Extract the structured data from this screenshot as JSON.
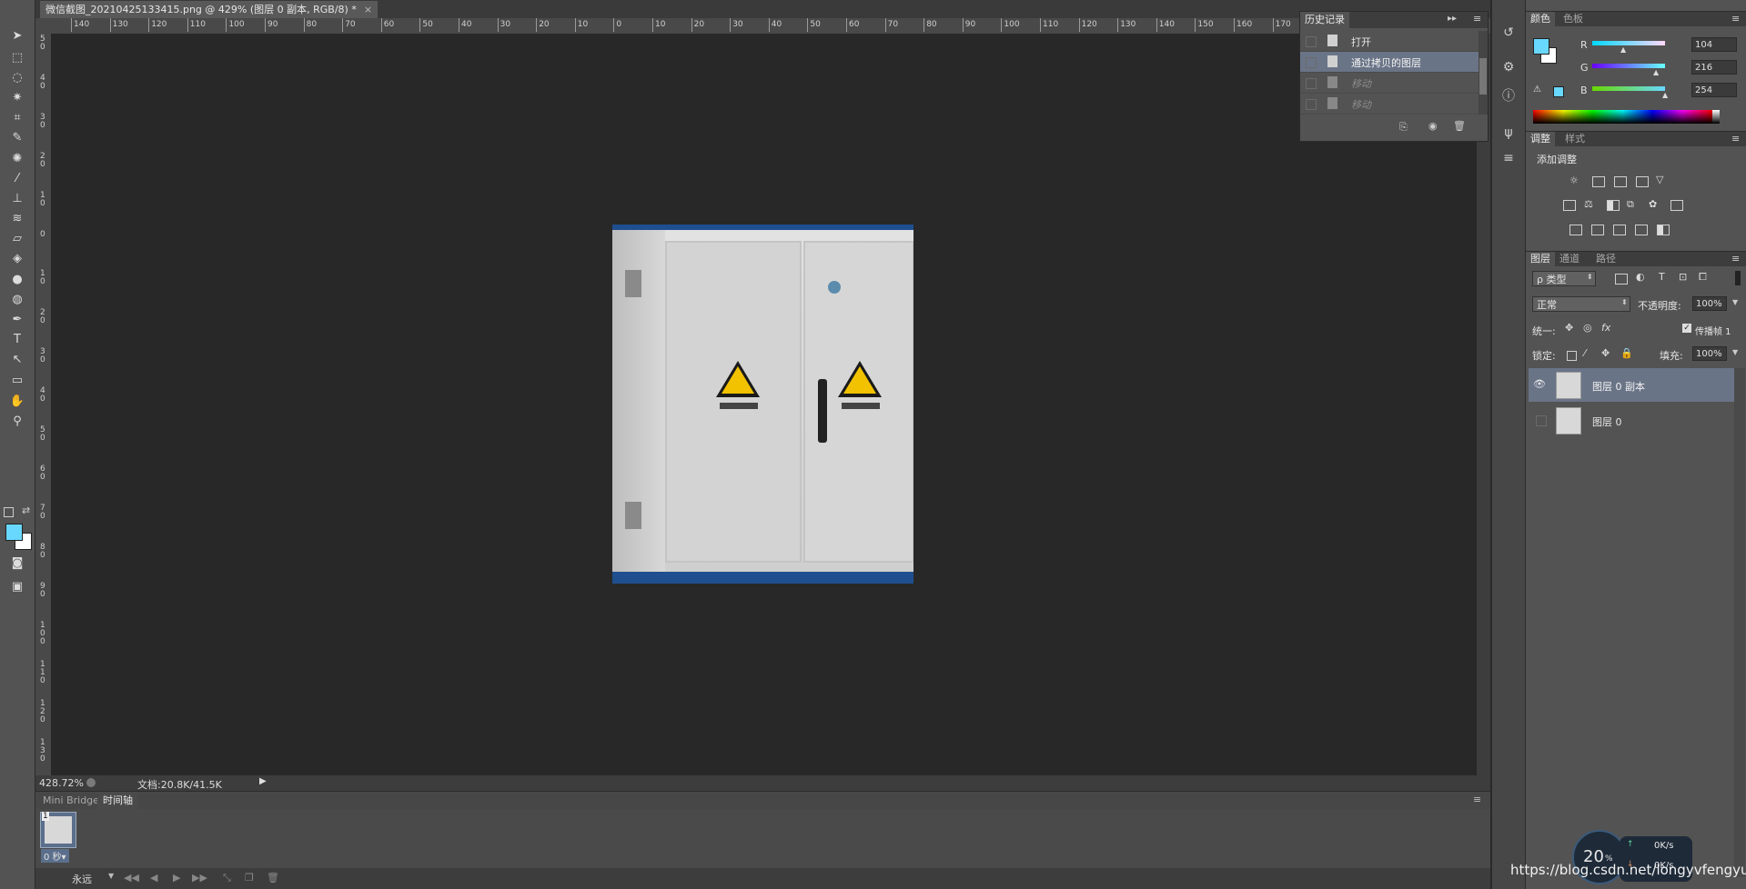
{
  "document_tab": {
    "title": "微信截图_20210425133415.png @ 429% (图层 0 副本, RGB/8) *",
    "close": "×"
  },
  "rulers": {
    "h_labels": [
      "140",
      "130",
      "120",
      "110",
      "100",
      "90",
      "80",
      "70",
      "60",
      "50",
      "40",
      "30",
      "20",
      "10",
      "0",
      "10",
      "20",
      "30",
      "40",
      "50",
      "60",
      "70",
      "80",
      "90",
      "100",
      "110",
      "120",
      "130",
      "140",
      "150",
      "160",
      "170"
    ],
    "v_labels": [
      "5 0",
      "4 0",
      "3 0",
      "2 0",
      "1 0",
      "0",
      "1 0",
      "2 0",
      "3 0",
      "4 0",
      "5 0",
      "6 0",
      "7 0",
      "8 0",
      "9 0",
      "1 0 0",
      "1 1 0",
      "1 2 0",
      "1 3 0"
    ]
  },
  "status": {
    "zoom": "428.72%",
    "doc": "文档:20.8K/41.5K"
  },
  "bottom_panel": {
    "tabs": [
      "Mini Bridge",
      "时间轴"
    ],
    "frame_number": "1",
    "frame_delay": "0 秒▾",
    "loop": "永远"
  },
  "history": {
    "title": "历史记录",
    "items": [
      {
        "label": "打开",
        "state": "normal"
      },
      {
        "label": "通过拷贝的图层",
        "state": "selected"
      },
      {
        "label": "移动",
        "state": "dim"
      },
      {
        "label": "移动",
        "state": "dim"
      }
    ]
  },
  "color_panel": {
    "tabs": [
      "颜色",
      "色板"
    ],
    "channels": [
      {
        "name": "R",
        "value": "104"
      },
      {
        "name": "G",
        "value": "216"
      },
      {
        "name": "B",
        "value": "254"
      }
    ],
    "foreground": "#68d8fe",
    "background": "#ffffff"
  },
  "adjust_panel": {
    "tabs": [
      "调整",
      "样式"
    ],
    "title": "添加调整"
  },
  "layers_panel": {
    "tabs": [
      "图层",
      "通道",
      "路径"
    ],
    "filter_kind": "ρ 类型",
    "blend_mode": "正常",
    "opacity_label": "不透明度:",
    "opacity": "100%",
    "unify_label": "统一:",
    "propagate_label": "传播帧 1",
    "lock_label": "锁定:",
    "fill_label": "填充:",
    "fill": "100%",
    "layers": [
      {
        "name": "图层 0 副本",
        "visible": true,
        "selected": true
      },
      {
        "name": "图层 0",
        "visible": false,
        "selected": false
      }
    ]
  },
  "network_widget": {
    "percent": "20",
    "unit": "%",
    "up": "0K/s",
    "down": "0K/s"
  },
  "watermark": "https://blog.csdn.net/longyvfengyun"
}
